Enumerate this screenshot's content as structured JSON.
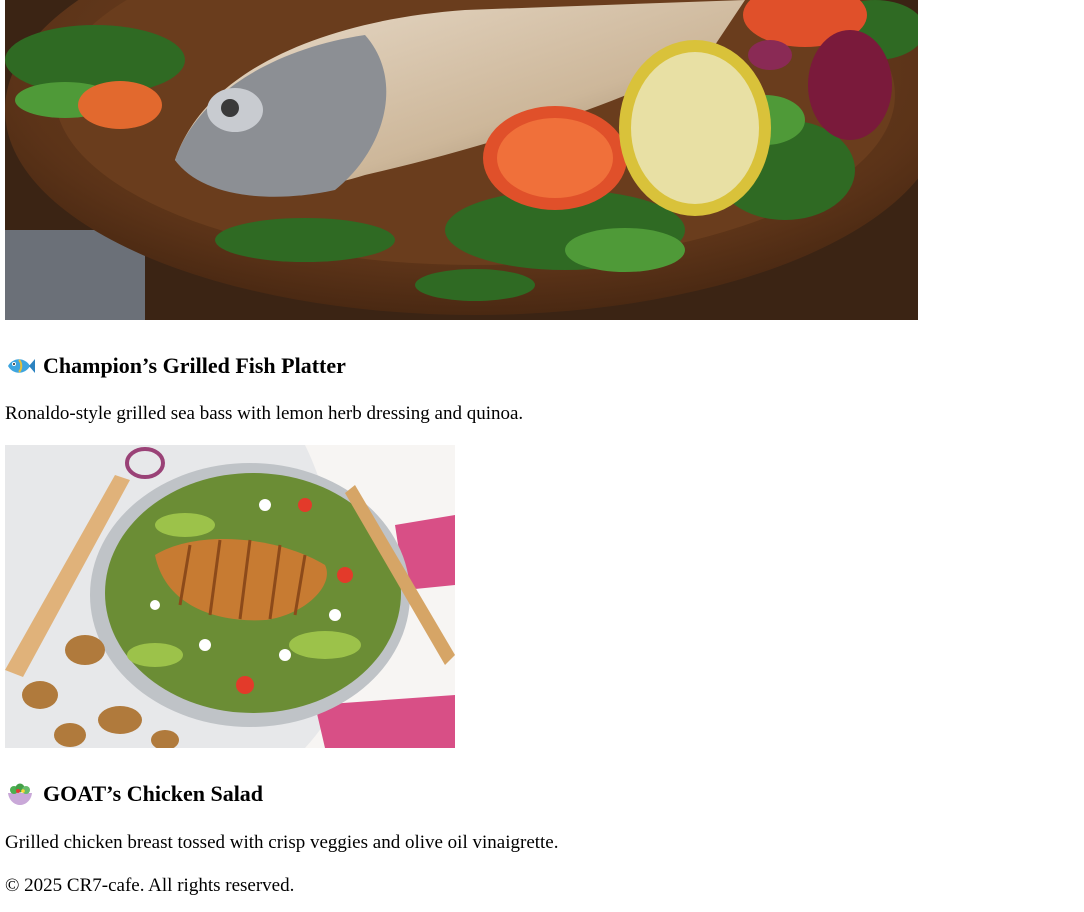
{
  "menu": {
    "items": [
      {
        "image_subject": "grilled sea bass with salad on wooden plate",
        "icon": "fish-icon",
        "title": "Champion’s Grilled Fish Platter",
        "description": "Ronaldo-style grilled sea bass with lemon herb dressing and quinoa."
      },
      {
        "image_subject": "chicken salad bowl with walnuts and pear",
        "icon": "salad-bowl-icon",
        "title": "GOAT’s Chicken Salad",
        "description": "Grilled chicken breast tossed with crisp veggies and olive oil vinaigrette."
      }
    ]
  },
  "footer": {
    "text": "© 2025 CR7-cafe. All rights reserved."
  }
}
